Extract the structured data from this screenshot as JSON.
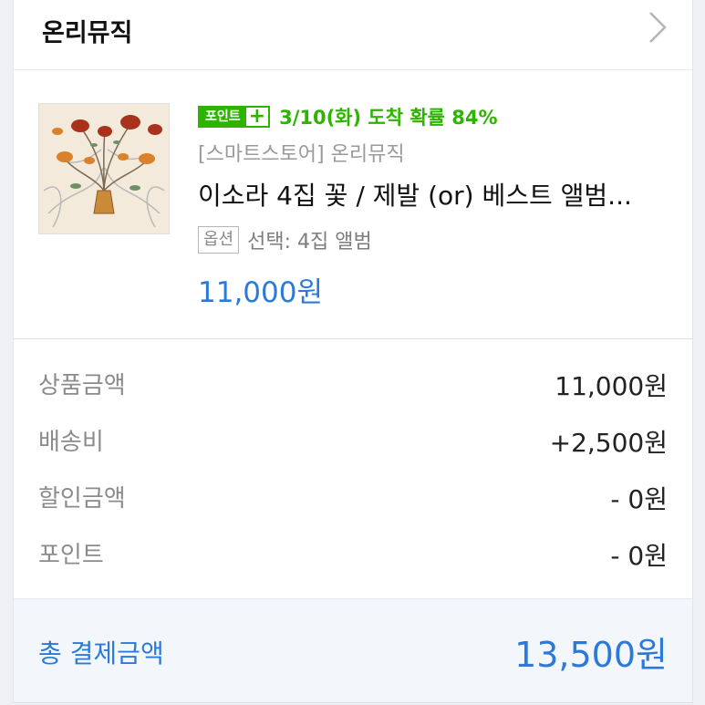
{
  "store": {
    "name": "온리뮤직",
    "chevron_icon": "chevron-right-icon"
  },
  "product": {
    "thumbnail_icon": "flower-illustration",
    "point_badge": {
      "label": "포인트",
      "plus": "+"
    },
    "delivery_text": "3/10(화) 도착 확률 84%",
    "seller": "[스마트스토어] 온리뮤직",
    "title": "이소라 4집 꽃 / 제발 (or) 베스트 앨범...",
    "option_badge": "옵션",
    "option_text": "선택: 4집 앨범",
    "price": "11,000원"
  },
  "summary": {
    "rows": [
      {
        "label": "상품금액",
        "value": "11,000원"
      },
      {
        "label": "배송비",
        "value": "+2,500원"
      },
      {
        "label": "할인금액",
        "value": "- 0원"
      },
      {
        "label": "포인트",
        "value": "- 0원"
      }
    ],
    "total_label": "총 결제금액",
    "total_value": "13,500원"
  },
  "colors": {
    "accent_blue": "#2b7ad8",
    "point_green": "#2db400"
  }
}
